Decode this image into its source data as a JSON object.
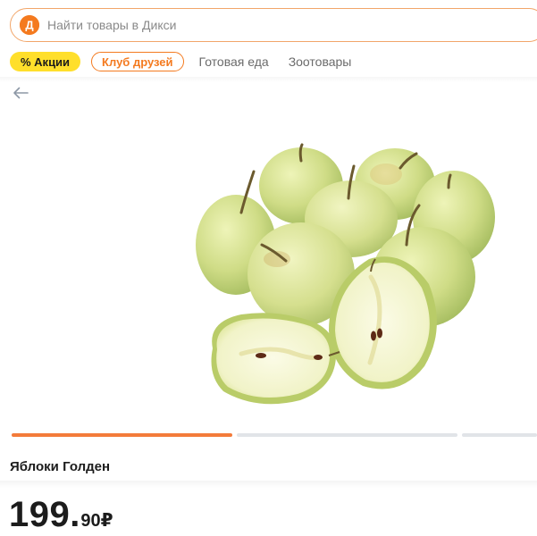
{
  "search": {
    "placeholder": "Найти товары в Дикси",
    "value": "",
    "logo_letter": "Д"
  },
  "chips": {
    "promo": "% Акции",
    "club": "Клуб друзей",
    "links": [
      "Готовая еда",
      "Зоотовары"
    ]
  },
  "gallery": {
    "total": 3,
    "active_index": 0
  },
  "product": {
    "name": "Яблоки Голден",
    "price_rub": "199",
    "price_sep": ".",
    "price_kop": "90",
    "currency": "₽"
  },
  "colors": {
    "brand_orange": "#f47a1f",
    "promo_yellow": "#ffdf2b",
    "bar_active": "#f37b3a",
    "bar_inactive": "#e1e4e8"
  },
  "icons": {
    "logo": "dixy-logo-icon",
    "back": "arrow-left-icon",
    "product": "golden-apples-photo"
  }
}
